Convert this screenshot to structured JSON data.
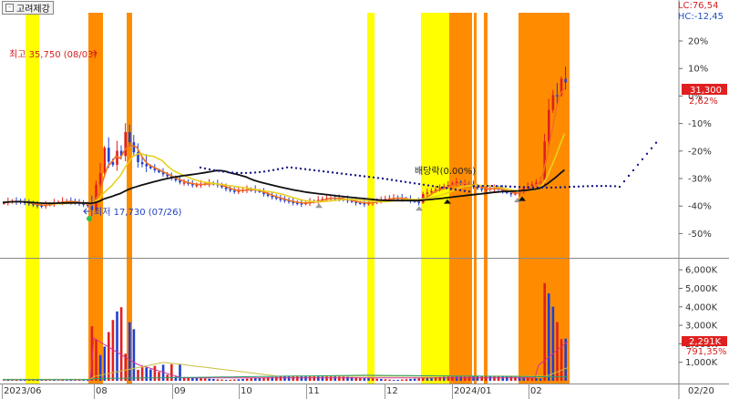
{
  "tab": {
    "title": "고려제강"
  },
  "lc_hc": {
    "lc": "LC:76,54",
    "hc": "HC:-12,45"
  },
  "price_axis": {
    "ticks": [
      "20%",
      "10%",
      "0%",
      "-10%",
      "-20%",
      "-30%",
      "-40%",
      "-50%"
    ]
  },
  "volume_axis": {
    "ticks": [
      "6,000K",
      "5,000K",
      "4,000K",
      "3,000K",
      "2,000K",
      "1,000K"
    ]
  },
  "date_axis": {
    "labels": [
      "2023/06",
      "08",
      "09",
      "10",
      "11",
      "12",
      "2024/01",
      "02",
      "02/20"
    ]
  },
  "annotations": {
    "high": "최고 35,750 (08/03)",
    "low": "최저 17,730 (07/26)",
    "dividend": "배당락(0.00%)"
  },
  "current": {
    "price": "31,300",
    "change": "2,62%",
    "volume": "2,291K",
    "volume_ratio": "791,35%"
  },
  "colors": {
    "yellow_band": "#ffff00",
    "orange_band": "#ff8c00",
    "up": "#e02020",
    "down": "#2040d0",
    "ma_orange": "#f07020",
    "ma_yellow": "#e8d020",
    "ma_black": "#101010",
    "ma_green": "#30a050",
    "trail": "#1a1a8c",
    "current_bg": "#e02020"
  },
  "chart_data": {
    "type": "candlestick",
    "x_start": "2023/06",
    "x_end": "2024/02/20",
    "y_axis_unit": "%",
    "ylim": [
      -55,
      25
    ],
    "volume_ylim_k": [
      0,
      6500
    ],
    "events": [
      "최고 35,750 (08/03)",
      "최저 17,730 (07/26)",
      "배당락(0.00%)"
    ],
    "last": {
      "price": 31300,
      "change_pct": 2.62,
      "volume_k": 2291,
      "volume_ratio_pct": 791.35
    }
  }
}
